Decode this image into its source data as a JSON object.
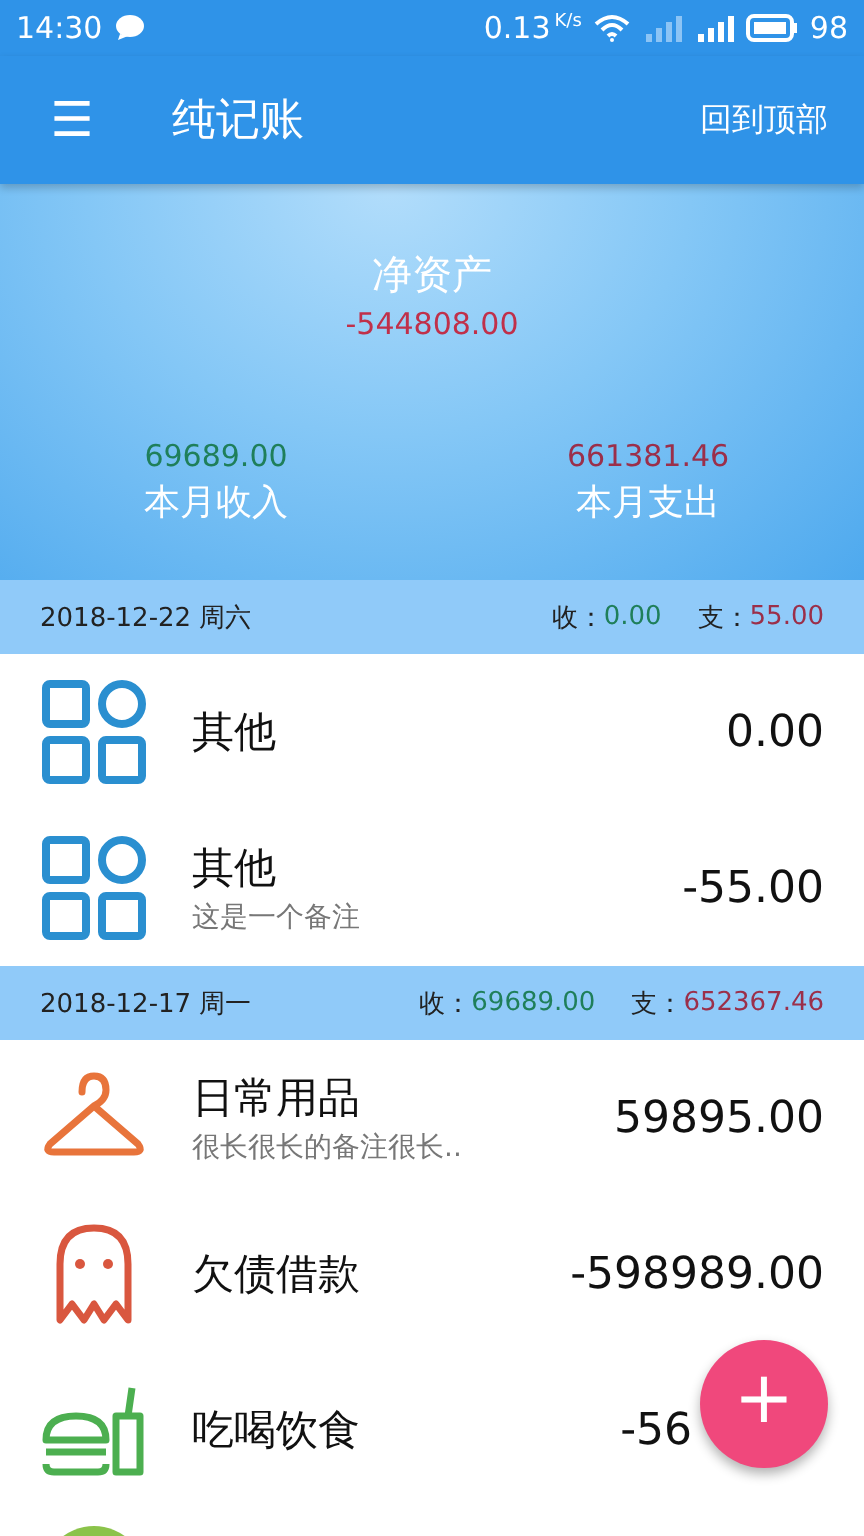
{
  "status_bar": {
    "time": "14:30",
    "speed": "0.13",
    "speed_unit": "K/s",
    "battery": "98"
  },
  "app_bar": {
    "menu": "☰",
    "title": "纯记账",
    "action": "回到顶部"
  },
  "summary": {
    "net_label": "净资产",
    "net_value": "-544808.00",
    "income_value": "69689.00",
    "income_label": "本月收入",
    "expense_value": "661381.46",
    "expense_label": "本月支出"
  },
  "days": [
    {
      "date": "2018-12-22 周六",
      "income_label": "收：",
      "income": "0.00",
      "expense_label": "支：",
      "expense": "55.00",
      "entries": [
        {
          "kind": "grid",
          "color": "#2a8fd0",
          "category": "其他",
          "amount": "0.00"
        },
        {
          "kind": "grid",
          "color": "#2a8fd0",
          "category": "其他",
          "note": "这是一个备注",
          "amount": "-55.00"
        }
      ]
    },
    {
      "date": "2018-12-17 周一",
      "income_label": "收：",
      "income": "69689.00",
      "expense_label": "支：",
      "expense": "652367.46",
      "entries": [
        {
          "kind": "hanger",
          "color": "#e8743b",
          "category": "日常用品",
          "note": "很长很长的备注很长..",
          "amount": "59895.00"
        },
        {
          "kind": "ghost",
          "color": "#d9573f",
          "category": "欠债借款",
          "amount": "-598989.00"
        },
        {
          "kind": "food",
          "color": "#4caf50",
          "category": "吃喝饮食",
          "amount": "-56"
        },
        {
          "kind": "circle",
          "color": "#8bc34a"
        }
      ]
    }
  ],
  "fab": "+"
}
